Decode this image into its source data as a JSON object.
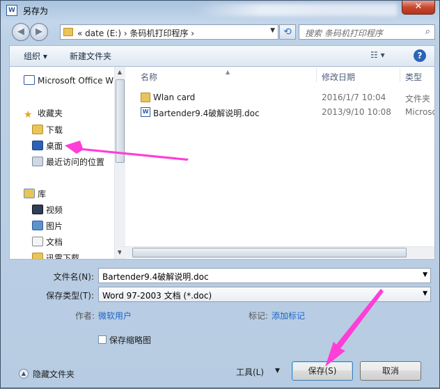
{
  "window": {
    "title": "另存为",
    "close": "✕"
  },
  "nav": {
    "address_crumbs": "«  date (E:)  ›  条码机打印程序  ›",
    "search_placeholder": "搜索 条码机打印程序"
  },
  "toolbar": {
    "organize": "组织 ▾",
    "new_folder": "新建文件夹",
    "view": "☷ ▾",
    "help": "?"
  },
  "sidebar": {
    "items": [
      {
        "label": "Microsoft Office W",
        "icon": "word-doc-icon"
      },
      {
        "label": "收藏夹",
        "icon": "star-icon"
      },
      {
        "label": "下载",
        "icon": "download-folder-icon"
      },
      {
        "label": "桌面",
        "icon": "desktop-icon"
      },
      {
        "label": "最近访问的位置",
        "icon": "recent-places-icon"
      },
      {
        "label": "库",
        "icon": "library-icon"
      },
      {
        "label": "视频",
        "icon": "video-icon"
      },
      {
        "label": "图片",
        "icon": "pictures-icon"
      },
      {
        "label": "文档",
        "icon": "documents-icon"
      },
      {
        "label": "迅雷下载",
        "icon": "thunder-folder-icon"
      }
    ]
  },
  "columns": {
    "name": "名称",
    "modified": "修改日期",
    "type": "类型"
  },
  "files": [
    {
      "name": "Wlan card",
      "modified": "2016/1/7 10:04",
      "type": "文件夹",
      "icon": "folder-icon"
    },
    {
      "name": "Bartender9.4破解说明.doc",
      "modified": "2013/9/10 10:08",
      "type": "Microso",
      "icon": "word-doc-icon"
    }
  ],
  "form": {
    "filename_label": "文件名(N):",
    "filename_value": "Bartender9.4破解说明.doc",
    "filetype_label": "保存类型(T):",
    "filetype_value": "Word 97-2003 文档 (*.doc)",
    "author_label": "作者:",
    "author_value": "微软用户",
    "tags_label": "标记:",
    "tags_value": "添加标记",
    "thumbnail_label": "保存缩略图"
  },
  "footer": {
    "hide_folders": "隐藏文件夹",
    "tools": "工具(L)",
    "save": "保存(S)",
    "cancel": "取消"
  },
  "colors": {
    "accent_link": "#1d63c7",
    "annotation_arrow": "#ff3ed7"
  }
}
